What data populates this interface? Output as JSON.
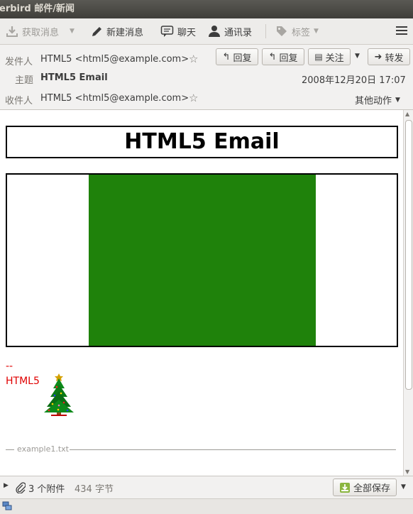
{
  "window": {
    "title": "erbird 邮件/新闻"
  },
  "toolbar": {
    "get_messages": "获取消息",
    "new_message": "新建消息",
    "chat": "聊天",
    "address_book": "通讯录",
    "tags": "标签"
  },
  "header": {
    "from_label": "发件人",
    "from_value": "HTML5 <html5@example.com>",
    "subject_label": "主题",
    "subject_value": "HTML5 Email",
    "to_label": "收件人",
    "to_value": "HTML5 <html5@example.com>",
    "date": "2008年12月20日 17:07",
    "reply": "回复",
    "reply_all": "回复",
    "follow": "关注",
    "forward": "转发",
    "other_actions": "其他动作"
  },
  "body": {
    "heading": "HTML5 Email",
    "canvas_fill_color": "#1f820b",
    "signature_dashes": "--",
    "signature_name": "HTML5",
    "attachment_inline_name": "example1.txt"
  },
  "footer": {
    "attachment_count": "3 个附件",
    "attachment_size": "434 字节",
    "save_all": "全部保存"
  }
}
